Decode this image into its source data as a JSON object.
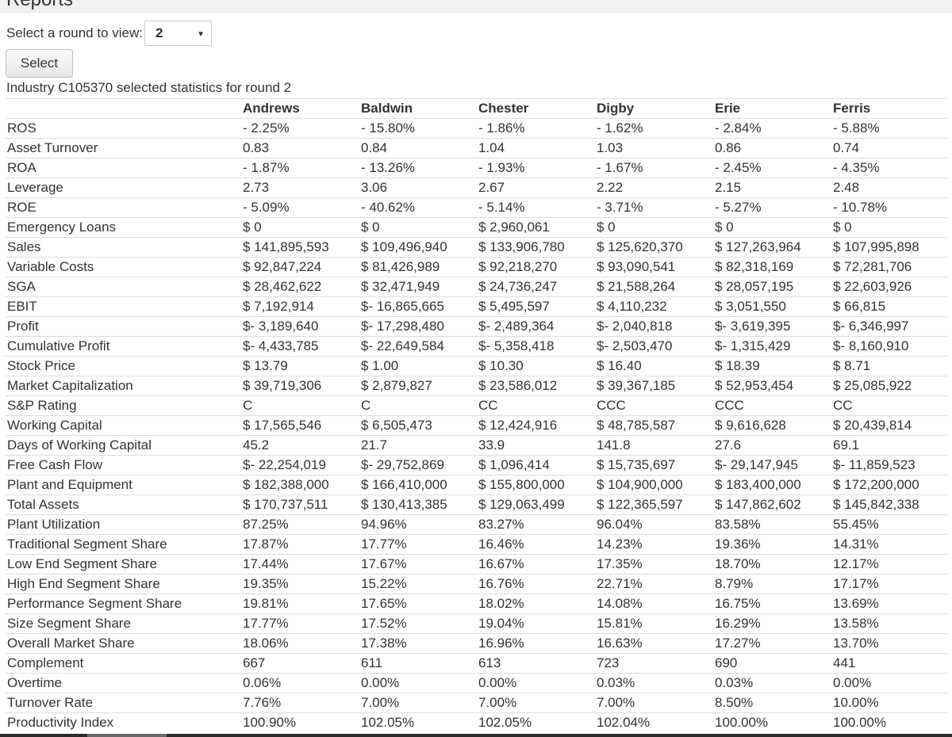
{
  "page": {
    "heading": "Reports"
  },
  "round_select": {
    "label": "Select a round to view:",
    "value": "2"
  },
  "select_button": {
    "label": "Select"
  },
  "caption": "Industry C105370 selected statistics for round 2",
  "table": {
    "columns": [
      "",
      "Andrews",
      "Baldwin",
      "Chester",
      "Digby",
      "Erie",
      "Ferris"
    ],
    "rows": [
      {
        "metric": "ROS",
        "values": [
          "- 2.25%",
          "- 15.80%",
          "- 1.86%",
          "- 1.62%",
          "- 2.84%",
          "- 5.88%"
        ]
      },
      {
        "metric": "Asset Turnover",
        "values": [
          "0.83",
          "0.84",
          "1.04",
          "1.03",
          "0.86",
          "0.74"
        ]
      },
      {
        "metric": "ROA",
        "values": [
          "- 1.87%",
          "- 13.26%",
          "- 1.93%",
          "- 1.67%",
          "- 2.45%",
          "- 4.35%"
        ]
      },
      {
        "metric": "Leverage",
        "values": [
          "2.73",
          "3.06",
          "2.67",
          "2.22",
          "2.15",
          "2.48"
        ]
      },
      {
        "metric": "ROE",
        "values": [
          "- 5.09%",
          "- 40.62%",
          "- 5.14%",
          "- 3.71%",
          "- 5.27%",
          "- 10.78%"
        ]
      },
      {
        "metric": "Emergency Loans",
        "values": [
          "$ 0",
          "$ 0",
          "$ 2,960,061",
          "$ 0",
          "$ 0",
          "$ 0"
        ]
      },
      {
        "metric": "Sales",
        "values": [
          "$ 141,895,593",
          "$ 109,496,940",
          "$ 133,906,780",
          "$ 125,620,370",
          "$ 127,263,964",
          "$ 107,995,898"
        ]
      },
      {
        "metric": "Variable Costs",
        "values": [
          "$ 92,847,224",
          "$ 81,426,989",
          "$ 92,218,270",
          "$ 93,090,541",
          "$ 82,318,169",
          "$ 72,281,706"
        ]
      },
      {
        "metric": "SGA",
        "values": [
          "$ 28,462,622",
          "$ 32,471,949",
          "$ 24,736,247",
          "$ 21,588,264",
          "$ 28,057,195",
          "$ 22,603,926"
        ]
      },
      {
        "metric": "EBIT",
        "values": [
          "$ 7,192,914",
          "$- 16,865,665",
          "$ 5,495,597",
          "$ 4,110,232",
          "$ 3,051,550",
          "$ 66,815"
        ]
      },
      {
        "metric": "Profit",
        "values": [
          "$- 3,189,640",
          "$- 17,298,480",
          "$- 2,489,364",
          "$- 2,040,818",
          "$- 3,619,395",
          "$- 6,346,997"
        ]
      },
      {
        "metric": "Cumulative Profit",
        "values": [
          "$- 4,433,785",
          "$- 22,649,584",
          "$- 5,358,418",
          "$- 2,503,470",
          "$- 1,315,429",
          "$- 8,160,910"
        ]
      },
      {
        "metric": "Stock Price",
        "values": [
          "$ 13.79",
          "$ 1.00",
          "$ 10.30",
          "$ 16.40",
          "$ 18.39",
          "$ 8.71"
        ]
      },
      {
        "metric": "Market Capitalization",
        "values": [
          "$ 39,719,306",
          "$ 2,879,827",
          "$ 23,586,012",
          "$ 39,367,185",
          "$ 52,953,454",
          "$ 25,085,922"
        ]
      },
      {
        "metric": "S&P Rating",
        "values": [
          "C",
          "C",
          "CC",
          "CCC",
          "CCC",
          "CC"
        ]
      },
      {
        "metric": "Working Capital",
        "values": [
          "$ 17,565,546",
          "$ 6,505,473",
          "$ 12,424,916",
          "$ 48,785,587",
          "$ 9,616,628",
          "$ 20,439,814"
        ]
      },
      {
        "metric": "Days of Working Capital",
        "values": [
          "45.2",
          "21.7",
          "33.9",
          "141.8",
          "27.6",
          "69.1"
        ]
      },
      {
        "metric": "Free Cash Flow",
        "values": [
          "$- 22,254,019",
          "$- 29,752,869",
          "$ 1,096,414",
          "$ 15,735,697",
          "$- 29,147,945",
          "$- 11,859,523"
        ]
      },
      {
        "metric": "Plant and Equipment",
        "values": [
          "$ 182,388,000",
          "$ 166,410,000",
          "$ 155,800,000",
          "$ 104,900,000",
          "$ 183,400,000",
          "$ 172,200,000"
        ]
      },
      {
        "metric": "Total Assets",
        "values": [
          "$ 170,737,511",
          "$ 130,413,385",
          "$ 129,063,499",
          "$ 122,365,597",
          "$ 147,862,602",
          "$ 145,842,338"
        ]
      },
      {
        "metric": "Plant Utilization",
        "values": [
          "87.25%",
          "94.96%",
          "83.27%",
          "96.04%",
          "83.58%",
          "55.45%"
        ]
      },
      {
        "metric": "Traditional Segment Share",
        "values": [
          "17.87%",
          "17.77%",
          "16.46%",
          "14.23%",
          "19.36%",
          "14.31%"
        ]
      },
      {
        "metric": "Low End Segment Share",
        "values": [
          "17.44%",
          "17.67%",
          "16.67%",
          "17.35%",
          "18.70%",
          "12.17%"
        ]
      },
      {
        "metric": "High End Segment Share",
        "values": [
          "19.35%",
          "15.22%",
          "16.76%",
          "22.71%",
          "8.79%",
          "17.17%"
        ]
      },
      {
        "metric": "Performance Segment Share",
        "values": [
          "19.81%",
          "17.65%",
          "18.02%",
          "14.08%",
          "16.75%",
          "13.69%"
        ]
      },
      {
        "metric": "Size Segment Share",
        "values": [
          "17.77%",
          "17.52%",
          "19.04%",
          "15.81%",
          "16.29%",
          "13.58%"
        ]
      },
      {
        "metric": "Overall Market Share",
        "values": [
          "18.06%",
          "17.38%",
          "16.96%",
          "16.63%",
          "17.27%",
          "13.70%"
        ]
      },
      {
        "metric": "Complement",
        "values": [
          "667",
          "611",
          "613",
          "723",
          "690",
          "441"
        ]
      },
      {
        "metric": "Overtime",
        "values": [
          "0.06%",
          "0.00%",
          "0.00%",
          "0.03%",
          "0.03%",
          "0.00%"
        ]
      },
      {
        "metric": "Turnover Rate",
        "values": [
          "7.76%",
          "7.00%",
          "7.00%",
          "7.00%",
          "8.50%",
          "10.00%"
        ]
      },
      {
        "metric": "Productivity Index",
        "values": [
          "100.90%",
          "102.05%",
          "102.05%",
          "102.04%",
          "100.00%",
          "100.00%"
        ]
      }
    ]
  }
}
